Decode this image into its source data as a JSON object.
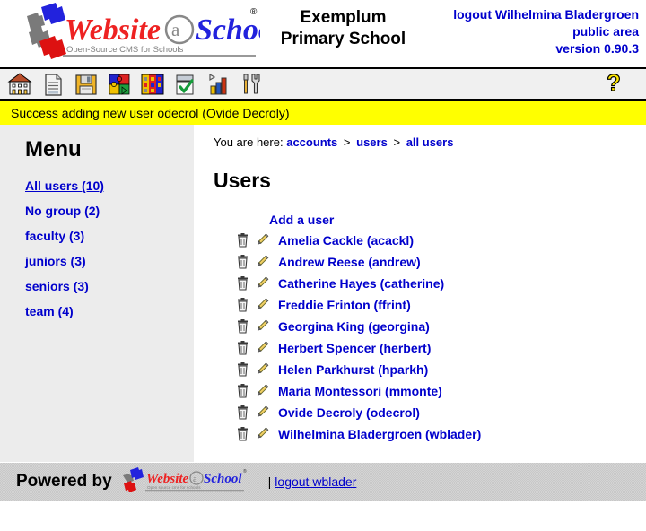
{
  "header": {
    "logo_alt": "Website@School",
    "logo_word1": "Website",
    "logo_word2": "@School",
    "logo_tagline": "Open-Source CMS for Schools",
    "logo_registered": "®",
    "school_name_line1": "Exemplum",
    "school_name_line2": "Primary School",
    "logout_label": "logout Wilhelmina Bladergroen",
    "area_label": "public area",
    "version_label": "version 0.90.3"
  },
  "toolbar": {
    "icons": [
      {
        "name": "school-icon",
        "title": "School"
      },
      {
        "name": "page-icon",
        "title": "Pages"
      },
      {
        "name": "floppy-disk-icon",
        "title": "Save"
      },
      {
        "name": "puzzle-modules-icon",
        "title": "Modules"
      },
      {
        "name": "colorful-blocks-icon",
        "title": "Areas"
      },
      {
        "name": "checklist-icon",
        "title": "Tasks"
      },
      {
        "name": "bar-chart-icon",
        "title": "Statistics"
      },
      {
        "name": "tools-icon",
        "title": "Tools"
      }
    ],
    "help": {
      "name": "help-question-icon",
      "label": "?"
    }
  },
  "message": {
    "text": "Success adding new user odecrol (Ovide Decroly)",
    "background": "#ffff00"
  },
  "breadcrumb": {
    "prefix": "You are here:",
    "separator": ">",
    "items": [
      {
        "label": "accounts"
      },
      {
        "label": "users"
      },
      {
        "label": "all users"
      }
    ]
  },
  "sidebar": {
    "title": "Menu",
    "items": [
      {
        "label": "All users (10)",
        "active": true
      },
      {
        "label": "No group (2)",
        "active": false
      },
      {
        "label": "faculty (3)",
        "active": false
      },
      {
        "label": "juniors (3)",
        "active": false
      },
      {
        "label": "seniors (3)",
        "active": false
      },
      {
        "label": "team (4)",
        "active": false
      }
    ]
  },
  "main": {
    "title": "Users",
    "add_user_label": "Add a user",
    "users": [
      {
        "label": "Amelia Cackle (acackl)"
      },
      {
        "label": "Andrew Reese (andrew)"
      },
      {
        "label": "Catherine Hayes (catherine)"
      },
      {
        "label": "Freddie Frinton (ffrint)"
      },
      {
        "label": "Georgina King (georgina)"
      },
      {
        "label": "Herbert Spencer (herbert)"
      },
      {
        "label": "Helen Parkhurst (hparkh)"
      },
      {
        "label": "Maria Montessori (mmonte)"
      },
      {
        "label": "Ovide Decroly (odecrol)"
      },
      {
        "label": "Wilhelmina Bladergroen (wblader)"
      }
    ],
    "row_icons": {
      "delete": "trash-icon",
      "edit": "pencil-icon"
    }
  },
  "footer": {
    "powered_by": "Powered by",
    "logo_word1": "Website",
    "logo_word2": "@School",
    "logo_tagline": "Open source cms for schools",
    "separator": "|",
    "logout_label": "logout wblader"
  },
  "colors": {
    "link": "#0000cc",
    "message_bg": "#ffff00",
    "sidebar_bg": "#ececec",
    "toolbar_bg": "#f0f0f0",
    "footer_bg": "#d4d4d4",
    "logo_red": "#ee2222",
    "logo_blue": "#2222dd"
  }
}
